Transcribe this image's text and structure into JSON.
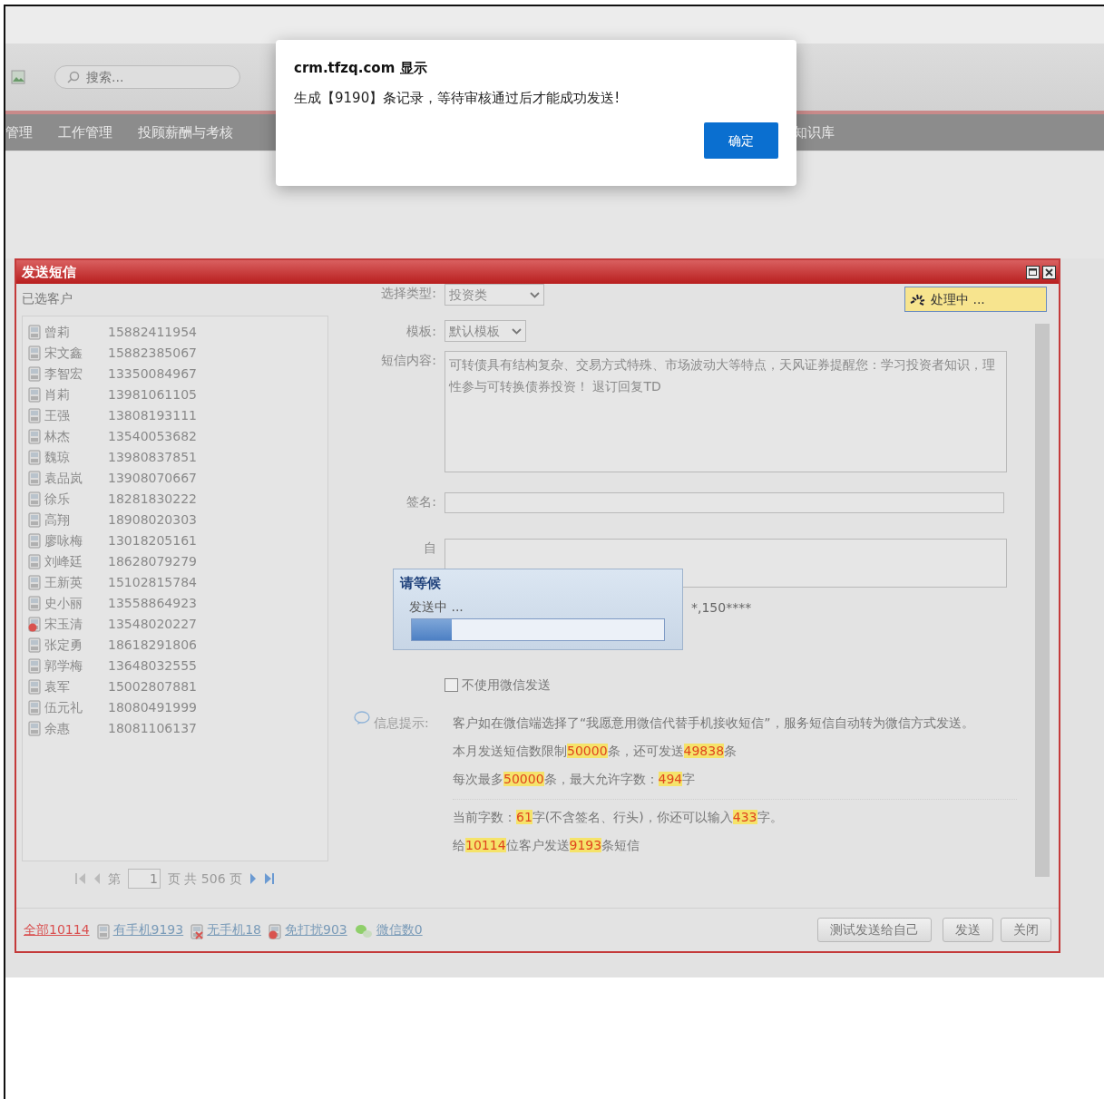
{
  "background": {
    "search": {
      "placeholder": "搜索..."
    },
    "nav_menu": [
      {
        "label": "管理"
      },
      {
        "label": "工作管理"
      },
      {
        "label": "投顾薪酬与考核"
      },
      {
        "label": "知识库"
      }
    ]
  },
  "sms_dialog": {
    "title": "发送短信",
    "customers": {
      "title": "已选客户",
      "rows": [
        {
          "name": "曾莉",
          "phone": "15882411954",
          "kind": "phone"
        },
        {
          "name": "宋文鑫",
          "phone": "15882385067",
          "kind": "phone"
        },
        {
          "name": "李智宏",
          "phone": "13350084967",
          "kind": "phone"
        },
        {
          "name": "肖莉",
          "phone": "13981061105",
          "kind": "phone"
        },
        {
          "name": "王强",
          "phone": "13808193111",
          "kind": "phone"
        },
        {
          "name": "林杰",
          "phone": "13540053682",
          "kind": "phone"
        },
        {
          "name": "魏琼",
          "phone": "13980837851",
          "kind": "phone"
        },
        {
          "name": "袁品岚",
          "phone": "13908070667",
          "kind": "phone"
        },
        {
          "name": "徐乐",
          "phone": "18281830222",
          "kind": "phone"
        },
        {
          "name": "高翔",
          "phone": "18908020303",
          "kind": "phone"
        },
        {
          "name": "廖咏梅",
          "phone": "13018205161",
          "kind": "phone"
        },
        {
          "name": "刘峰廷",
          "phone": "18628079279",
          "kind": "phone"
        },
        {
          "name": "王新英",
          "phone": "15102815784",
          "kind": "phone"
        },
        {
          "name": "史小丽",
          "phone": "13558864923",
          "kind": "phone"
        },
        {
          "name": "宋玉清",
          "phone": "13548020227",
          "kind": "blocked"
        },
        {
          "name": "张定勇",
          "phone": "18618291806",
          "kind": "phone"
        },
        {
          "name": "郭学梅",
          "phone": "13648032555",
          "kind": "phone"
        },
        {
          "name": "袁军",
          "phone": "15002807881",
          "kind": "phone"
        },
        {
          "name": "伍元礼",
          "phone": "18080491999",
          "kind": "phone"
        },
        {
          "name": "余惠",
          "phone": "18081106137",
          "kind": "phone"
        }
      ],
      "pager": {
        "before": "第",
        "page": "1",
        "after": "页 共 506 页"
      }
    },
    "form": {
      "type_label": "选择类型:",
      "type_value": "投资类",
      "template_label": "模板:",
      "template_value": "默认模板",
      "content_label": "短信内容:",
      "content": "可转债具有结构复杂、交易方式特殊、市场波动大等特点，天风证券提醒您：学习投资者知识，理性参与可转换债券投资！ 退订回复TD",
      "signature_label": "签名:",
      "custom_label": "自",
      "recipients_preview": "*,150****",
      "wechat_checkbox": {
        "label": "不使用微信发送",
        "checked": false
      },
      "info_label": "信息提示:",
      "info_lines": [
        [
          {
            "text": "客户如在微信端选择了“我愿意用微信代替手机接收短信”，服务短信自动转为微信方式发送。",
            "highlight": false
          }
        ],
        [
          {
            "text": "本月发送短信数限制",
            "highlight": false
          },
          {
            "text": "50000",
            "highlight": true
          },
          {
            "text": "条，还可发送",
            "highlight": false
          },
          {
            "text": "49838",
            "highlight": true
          },
          {
            "text": "条",
            "highlight": false
          }
        ],
        [
          {
            "text": "每次最多",
            "highlight": false
          },
          {
            "text": "50000",
            "highlight": true
          },
          {
            "text": "条，最大允许字数：",
            "highlight": false
          },
          {
            "text": "494",
            "highlight": true
          },
          {
            "text": "字",
            "highlight": false
          }
        ]
      ],
      "count_lines": [
        [
          {
            "text": "当前字数：",
            "highlight": false
          },
          {
            "text": "61",
            "highlight": true
          },
          {
            "text": "字(不含签名、行头)，你还可以输入",
            "highlight": false
          },
          {
            "text": "433",
            "highlight": true
          },
          {
            "text": "字。",
            "highlight": false
          }
        ],
        [
          {
            "text": "给",
            "highlight": false
          },
          {
            "text": "10114",
            "highlight": true
          },
          {
            "text": "位客户发送",
            "highlight": false
          },
          {
            "text": "9193",
            "highlight": true
          },
          {
            "text": "条短信",
            "highlight": false
          }
        ]
      ]
    },
    "processing": "处理中 ...",
    "footer_links": [
      {
        "label": "全部10114",
        "kind": "all",
        "selected": true
      },
      {
        "label": "有手机9193",
        "kind": "phone",
        "selected": false
      },
      {
        "label": "无手机18",
        "kind": "no_phone",
        "selected": false
      },
      {
        "label": "免打扰903",
        "kind": "blocked",
        "selected": false
      },
      {
        "label": "微信数0",
        "kind": "wechat",
        "selected": false
      }
    ],
    "buttons": [
      "测试发送给自己",
      "发送",
      "关闭"
    ]
  },
  "wait_dialog": {
    "title": "请等候",
    "message": "发送中 ...",
    "level": 0.16
  },
  "alert": {
    "title": "crm.tfzq.com 显示",
    "message": "生成【9190】条记录，等待审核通过后才能成功发送!",
    "button": "确定"
  }
}
